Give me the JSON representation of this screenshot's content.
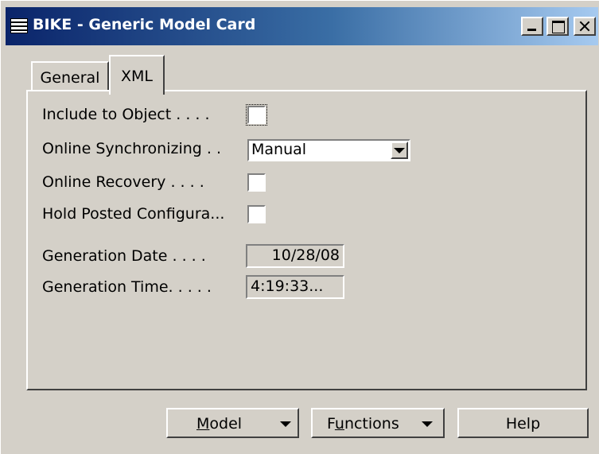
{
  "window": {
    "title": "BIKE - Generic Model Card",
    "icon": "table-icon"
  },
  "tabs": [
    {
      "label": "General",
      "active": false
    },
    {
      "label": "XML",
      "active": true
    }
  ],
  "fields": {
    "include_to_object": {
      "label": "Include to Object . . . .",
      "checked": false
    },
    "online_synchronizing": {
      "label": "Online Synchronizing . .",
      "value": "Manual"
    },
    "online_recovery": {
      "label": "Online Recovery . . . .",
      "checked": false
    },
    "hold_posted": {
      "label": "Hold Posted Configura...",
      "checked": false
    },
    "generation_date": {
      "label": "Generation Date . . . .",
      "value": "10/28/08"
    },
    "generation_time": {
      "label": "Generation Time. . . . .",
      "value": "4:19:33..."
    }
  },
  "buttons": {
    "model": {
      "label": "Model",
      "underline": "M"
    },
    "functions": {
      "label": "Functions",
      "underline": "u"
    },
    "help": {
      "label": "Help"
    }
  },
  "colors": {
    "face": "#d4d0c8",
    "titlebar_start": "#0a246a",
    "titlebar_end": "#a6caf0"
  }
}
